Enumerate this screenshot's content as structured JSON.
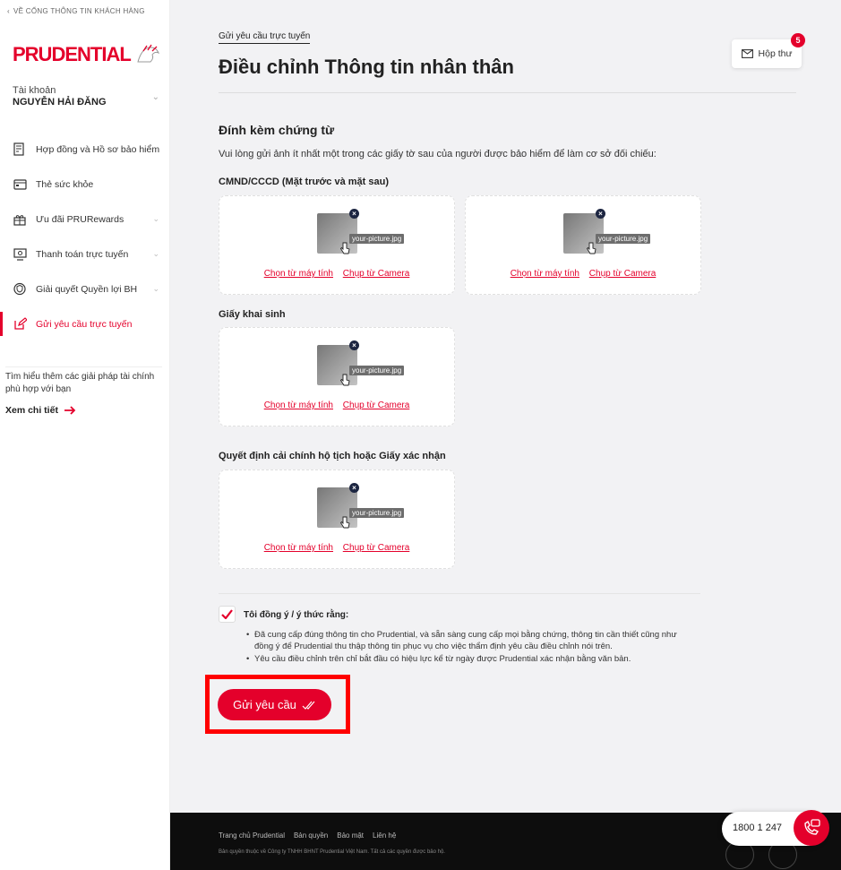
{
  "sidebar": {
    "back_link": "VỀ CỔNG THÔNG TIN KHÁCH HÀNG",
    "logo": "PRUDENTIAL",
    "account_label": "Tài khoản",
    "account_name": "NGUYỄN HẢI ĐĂNG",
    "items": [
      {
        "label": "Hợp đồng và Hồ sơ bảo hiểm",
        "icon": "contract-icon"
      },
      {
        "label": "Thẻ sức khỏe",
        "icon": "card-icon"
      },
      {
        "label": "Ưu đãi PRURewards",
        "icon": "gift-icon"
      },
      {
        "label": "Thanh toán trực tuyến",
        "icon": "payment-icon"
      },
      {
        "label": "Giải quyết Quyền lợi BH",
        "icon": "shield-icon"
      },
      {
        "label": "Gửi yêu cầu trực tuyến",
        "icon": "edit-icon"
      }
    ],
    "promo_text": "Tìm hiểu thêm các giải pháp tài chính phù hợp với bạn",
    "promo_link": "Xem chi tiết"
  },
  "header": {
    "breadcrumb": "Gửi yêu cầu trực tuyến",
    "title": "Điều chỉnh Thông tin nhân thân",
    "inbox_label": "Hộp thư",
    "inbox_count": "5"
  },
  "main": {
    "section_title": "Đính kèm chứng từ",
    "section_desc": "Vui lòng gửi ảnh ít nhất một trong các giấy tờ sau của người được bảo hiểm để làm cơ sở đối chiếu:",
    "groups": [
      {
        "label": "CMND/CCCD (Mặt trước và mặt sau)"
      },
      {
        "label": "Giấy khai sinh"
      },
      {
        "label": "Quyết định cải chính hộ tịch hoặc Giấy xác nhận"
      }
    ],
    "upload": {
      "file_name": "your-picture.jpg",
      "choose_computer": "Chọn từ máy tính",
      "choose_camera": "Chụp từ Camera"
    },
    "agree_title": "Tôi đồng ý / ý thức rằng:",
    "agree_items": [
      "Đã cung cấp đúng thông tin cho Prudential, và sẵn sàng cung cấp mọi bằng chứng, thông tin cần thiết cũng như đồng ý để Prudential thu thập thông tin phục vụ cho việc thẩm định yêu cầu điều chỉnh nói trên.",
      "Yêu cầu điều chỉnh trên chỉ bắt đầu có hiệu lực kể từ ngày được Prudential xác nhận bằng văn bản."
    ],
    "submit_label": "Gửi yêu cầu"
  },
  "footer": {
    "links": [
      "Trang chủ Prudential",
      "Bản quyền",
      "Bảo mật",
      "Liên hệ"
    ],
    "copyright": "Bản quyền thuộc về Công ty TNHH BHNT Prudential Việt Nam. Tất cả các quyền được bảo hộ.",
    "hotline": "1800 1 247"
  },
  "colors": {
    "brand": "#e4002b",
    "highlight": "#ff0000"
  }
}
